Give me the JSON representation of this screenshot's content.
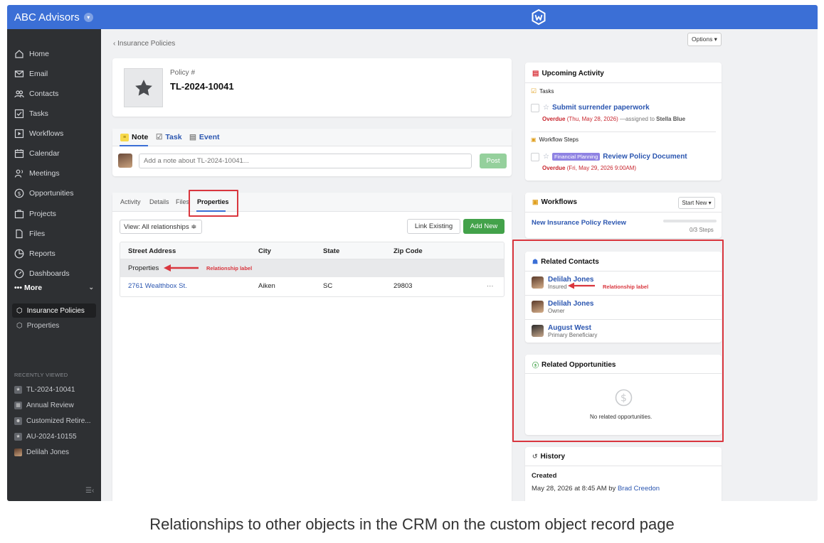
{
  "app": {
    "name": "ABC Advisors"
  },
  "sidebar": {
    "items": [
      {
        "label": "Home",
        "icon": "home-icon"
      },
      {
        "label": "Email",
        "icon": "email-icon"
      },
      {
        "label": "Contacts",
        "icon": "contacts-icon"
      },
      {
        "label": "Tasks",
        "icon": "tasks-icon"
      },
      {
        "label": "Workflows",
        "icon": "workflows-icon"
      },
      {
        "label": "Calendar",
        "icon": "calendar-icon"
      },
      {
        "label": "Meetings",
        "icon": "meetings-icon"
      },
      {
        "label": "Opportunities",
        "icon": "opportunities-icon"
      },
      {
        "label": "Projects",
        "icon": "projects-icon"
      },
      {
        "label": "Files",
        "icon": "files-icon"
      },
      {
        "label": "Reports",
        "icon": "reports-icon"
      },
      {
        "label": "Dashboards",
        "icon": "dashboards-icon"
      }
    ],
    "more_label": "More",
    "sub_items": [
      {
        "label": "Insurance Policies",
        "active": true
      },
      {
        "label": "Properties",
        "active": false
      }
    ],
    "recently_viewed_heading": "RECENTLY VIEWED",
    "recent": [
      {
        "label": "TL-2024-10041"
      },
      {
        "label": "Annual Review"
      },
      {
        "label": "Customized Retire..."
      },
      {
        "label": "AU-2024-10155"
      },
      {
        "label": "Delilah Jones"
      }
    ]
  },
  "header": {
    "breadcrumb": "‹ Insurance Policies",
    "options_label": "Options ▾"
  },
  "policy": {
    "label": "Policy #",
    "number": "TL-2024-10041"
  },
  "note_composer": {
    "tabs": [
      {
        "label": "Note"
      },
      {
        "label": "Task"
      },
      {
        "label": "Event"
      }
    ],
    "placeholder": "Add a note about TL-2024-10041...",
    "post_label": "Post"
  },
  "record_tabs": {
    "tabs": [
      "Activity",
      "Details",
      "Files",
      "Properties"
    ],
    "active": "Properties",
    "view_select": "View: All relationships ≑",
    "link_existing": "Link Existing",
    "add_new": "Add New",
    "table": {
      "columns": [
        "Street Address",
        "City",
        "State",
        "Zip Code"
      ],
      "group_label": "Properties",
      "rows": [
        {
          "street": "2761 Wealthbox St.",
          "city": "Aiken",
          "state": "SC",
          "zip": "29803",
          "actions": "···"
        }
      ]
    },
    "annotation": "Relationship label"
  },
  "upcoming": {
    "title": "Upcoming Activity",
    "tasks_heading": "Tasks",
    "task": {
      "title": "Submit surrender paperwork",
      "overdue": "Overdue",
      "date": "(Thu, May 28, 2026)",
      "assigned_prefix": "—assigned to",
      "assignee": "Stella Blue"
    },
    "workflow_heading": "Workflow Steps",
    "workflow_step": {
      "tag": "Financial Planning",
      "title": "Review Policy Document",
      "overdue": "Overdue",
      "date": "(Fri, May 29, 2026 9:00AM)"
    }
  },
  "workflows": {
    "title": "Workflows",
    "start_new": "Start New ▾",
    "item": "New Insurance Policy Review",
    "progress": 0,
    "steps": "0/3 Steps"
  },
  "related_contacts": {
    "title": "Related Contacts",
    "contacts": [
      {
        "name": "Delilah Jones",
        "role": "Insured"
      },
      {
        "name": "Delilah Jones",
        "role": "Owner"
      },
      {
        "name": "August West",
        "role": "Primary Beneficiary"
      }
    ],
    "annotation": "Relationship label"
  },
  "related_opportunities": {
    "title": "Related Opportunities",
    "empty": "No related opportunities."
  },
  "history": {
    "title": "History",
    "created_label": "Created",
    "created_text": "May 28, 2026 at 8:45 AM by",
    "created_by": "Brad Creedon"
  },
  "caption": "Relationships to other objects in the CRM on the custom object record page",
  "colors": {
    "topbar": "#3b6fd6",
    "sidebar": "#2e3033",
    "link": "#2b56b0",
    "overdue": "#c8262e",
    "highlight": "#d9363e",
    "add_button": "#43a24a"
  }
}
